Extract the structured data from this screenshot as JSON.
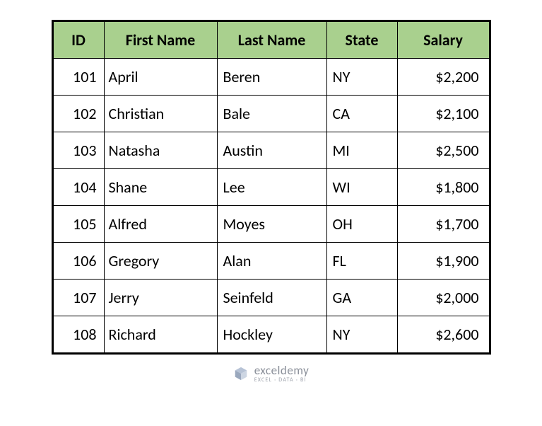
{
  "chart_data": {
    "type": "table",
    "headers": [
      "ID",
      "First Name",
      "Last Name",
      "State",
      "Salary"
    ],
    "rows": [
      {
        "id": "101",
        "first": "April",
        "last": "Beren",
        "state": "NY",
        "salary": "$2,200"
      },
      {
        "id": "102",
        "first": "Christian",
        "last": "Bale",
        "state": "CA",
        "salary": "$2,100"
      },
      {
        "id": "103",
        "first": "Natasha",
        "last": "Austin",
        "state": "MI",
        "salary": "$2,500"
      },
      {
        "id": "104",
        "first": "Shane",
        "last": "Lee",
        "state": "WI",
        "salary": "$1,800"
      },
      {
        "id": "105",
        "first": "Alfred",
        "last": "Moyes",
        "state": "OH",
        "salary": "$1,700"
      },
      {
        "id": "106",
        "first": "Gregory",
        "last": "Alan",
        "state": "FL",
        "salary": "$1,900"
      },
      {
        "id": "107",
        "first": "Jerry",
        "last": "Seinfeld",
        "state": "GA",
        "salary": "$2,000"
      },
      {
        "id": "108",
        "first": "Richard",
        "last": "Hockley",
        "state": "NY",
        "salary": "$2,600"
      }
    ]
  },
  "footer": {
    "brand": "exceldemy",
    "tagline": "EXCEL · DATA · BI"
  }
}
